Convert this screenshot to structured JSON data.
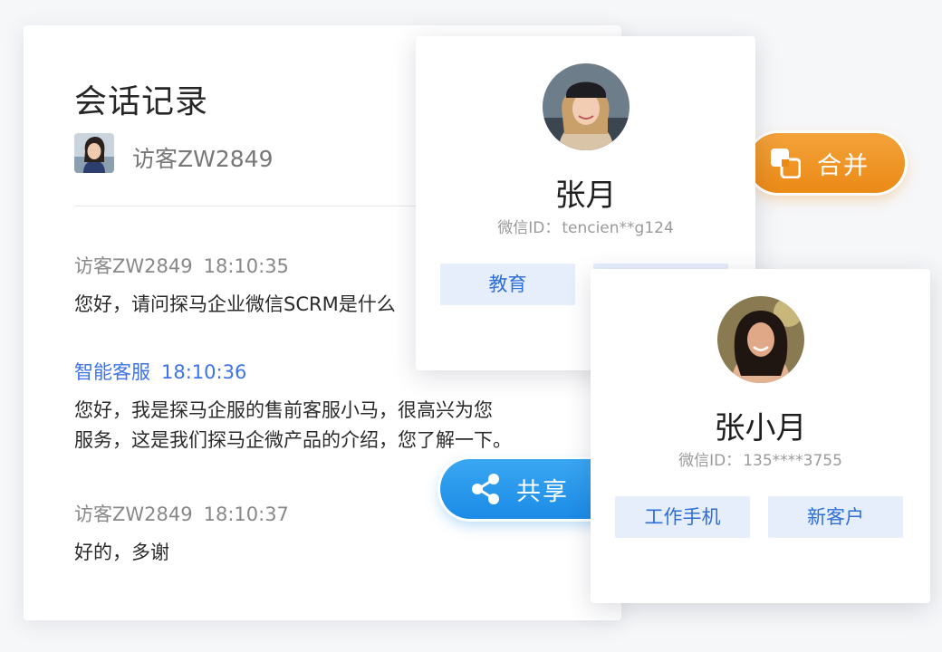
{
  "chat": {
    "title": "会话记录",
    "visitor_name": "访客ZW2849",
    "messages": [
      {
        "sender": "访客ZW2849",
        "time": "18:10:35",
        "role": "visitor",
        "lines": [
          "您好，请问探马企业微信SCRM是什么"
        ]
      },
      {
        "sender": "智能客服",
        "time": "18:10:36",
        "role": "agent",
        "lines": [
          "您好，我是探马企服的售前客服小马，很高兴为您",
          "服务，这是我们探马企微产品的介绍，您了解一下。"
        ]
      },
      {
        "sender": "访客ZW2849",
        "time": "18:10:37",
        "role": "visitor",
        "lines": [
          "好的，多谢"
        ]
      }
    ]
  },
  "cards": [
    {
      "name": "张月",
      "wechat_label": "微信ID：",
      "wechat_id": "tencien**g124",
      "tags": [
        "教育",
        ""
      ]
    },
    {
      "name": "张小月",
      "wechat_label": "微信ID：",
      "wechat_id": "135****3755",
      "tags": [
        "工作手机",
        "新客户"
      ]
    }
  ],
  "actions": {
    "merge": {
      "label": "合并",
      "icon": "merge-icon",
      "color": "#eb8a16"
    },
    "share": {
      "label": "共享",
      "icon": "share-icon",
      "color": "#1b8be6"
    }
  },
  "colors": {
    "agent_accent": "#3e72e8",
    "tag_bg": "#e6eefc",
    "tag_text": "#2d6fd6"
  }
}
